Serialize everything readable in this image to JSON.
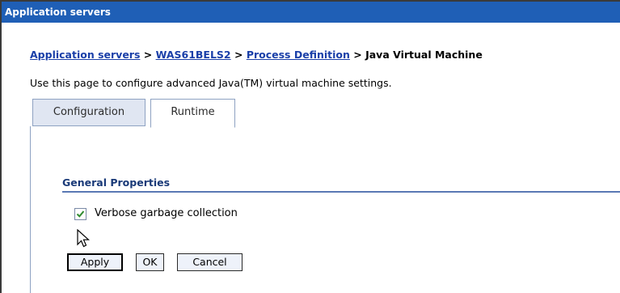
{
  "window": {
    "title": "Application servers"
  },
  "breadcrumb": {
    "items": [
      {
        "label": "Application servers",
        "link": true
      },
      {
        "label": "WAS61BELS2",
        "link": true
      },
      {
        "label": "Process Definition",
        "link": true
      },
      {
        "label": "Java Virtual Machine",
        "link": false
      }
    ],
    "separator": " > "
  },
  "description": "Use this page to configure advanced Java(TM) virtual machine settings.",
  "tabs": [
    {
      "label": "Configuration",
      "active": false
    },
    {
      "label": "Runtime",
      "active": true
    }
  ],
  "general_properties": {
    "title": "General Properties",
    "verbose_gc": {
      "label": "Verbose garbage collection",
      "checked": true
    }
  },
  "buttons": {
    "apply": "Apply",
    "ok": "OK",
    "cancel": "Cancel"
  },
  "colors": {
    "titlebar": "#1f5fb6",
    "link": "#1a3fa8",
    "check": "#2e8b2e"
  },
  "icons": {
    "cursor": "mouse-pointer-icon",
    "check": "checkmark-icon"
  }
}
